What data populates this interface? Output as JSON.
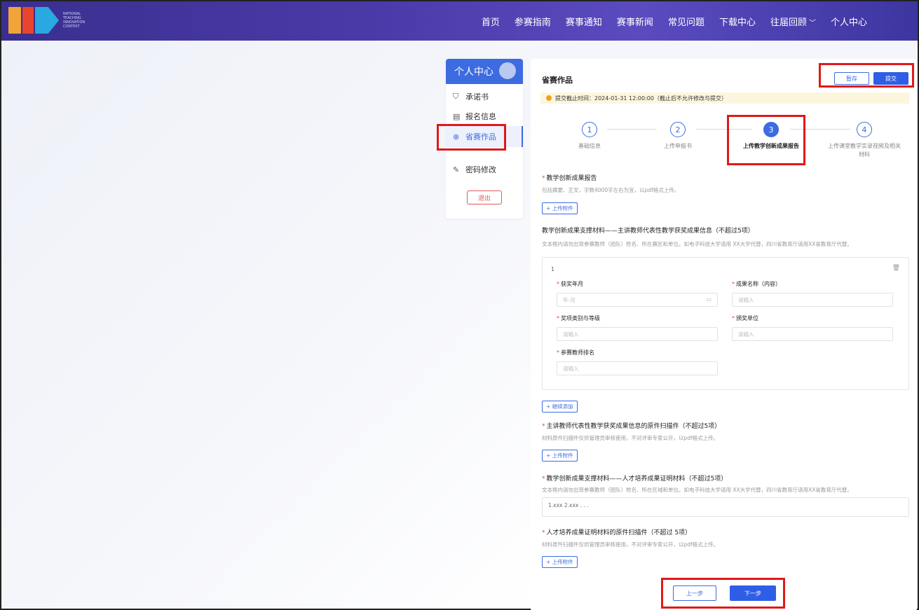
{
  "header": {
    "logo_text": "NATIONAL TEACHING INNOVATION CONTEST",
    "nav": [
      {
        "label": "首页"
      },
      {
        "label": "参赛指南"
      },
      {
        "label": "赛事通知"
      },
      {
        "label": "赛事新闻"
      },
      {
        "label": "常见问题"
      },
      {
        "label": "下载中心"
      },
      {
        "label": "往届回顾",
        "dropdown": true
      },
      {
        "label": "个人中心"
      }
    ]
  },
  "sidebar": {
    "title": "个人中心",
    "items": [
      {
        "label": "承诺书",
        "icon": "shield-icon"
      },
      {
        "label": "报名信息",
        "icon": "form-icon"
      },
      {
        "label": "省赛作品",
        "icon": "works-icon",
        "active": true
      },
      {
        "label": "密码修改",
        "icon": "edit-icon"
      }
    ],
    "logout": "退出"
  },
  "main": {
    "title": "省赛作品",
    "save": "暂存",
    "submit": "提交",
    "notice": "提交截止时间：2024-01-31 12:00:00（截止后不允许修改与提交）",
    "steps": [
      {
        "num": "1",
        "label": "基础信息"
      },
      {
        "num": "2",
        "label": "上传申报书"
      },
      {
        "num": "3",
        "label": "上传教学创新成果报告",
        "active": true
      },
      {
        "num": "4",
        "label": "上传课堂教学实录视频及相关材料"
      }
    ],
    "report": {
      "title": "教学创新成果报告",
      "hint": "包括摘要、正文，字数4000字左右为宜，以pdf格式上传。",
      "upload": "+ 上传附件"
    },
    "support1": {
      "title": "教学创新成果支撑材料——主讲教师代表性教学获奖成果信息（不超过5项）",
      "hint": "文本框内请勿出现参赛教师（团队）姓名、所在赛区和单位。如电子科技大学请用 XX大学代替，四川省教育厅请用XX省教育厅代替。"
    },
    "card": {
      "index": "1",
      "date_label": "获奖年月",
      "date_placeholder": "年-月",
      "name_label": "成果名称（内容）",
      "name_placeholder": "请输入",
      "category_label": "奖项类别与等级",
      "category_placeholder": "请输入",
      "issuer_label": "颁奖单位",
      "issuer_placeholder": "请输入",
      "rank_label": "参赛教师排名",
      "rank_placeholder": "请输入"
    },
    "add_more": "+ 继续添加",
    "scan1": {
      "title": "主讲教师代表性教学获奖成果信息的原件扫描件（不超过5项）",
      "hint": "材料原件扫描件仅供管理员审核使用，不对评审专家公开，以pdf格式上传。",
      "upload": "+ 上传附件"
    },
    "support2": {
      "title": "教学创新成果支撑材料——人才培养成果证明材料（不超过5项）",
      "hint": "文本框内请勿出现参赛教师（团队）姓名、所在区域和单位。如电子科技大学请用 XX大学代替，四川省教育厅请用XX省教育厅代替。",
      "value": "1.xxx 2.xxx . . ."
    },
    "scan2": {
      "title": "人才培养成果证明材料的原件扫描件（不超过 5项）",
      "hint": "材料原件扫描件仅供管理员审核使用，不对评审专家公开，以pdf格式上传。",
      "upload": "+ 上传附件"
    },
    "prev": "上一步",
    "next": "下一步"
  },
  "colors": {
    "accent": "#3d6be0",
    "header": "#4a3aa8",
    "annotation": "#e01919",
    "notice_bg": "#fdf6df"
  }
}
